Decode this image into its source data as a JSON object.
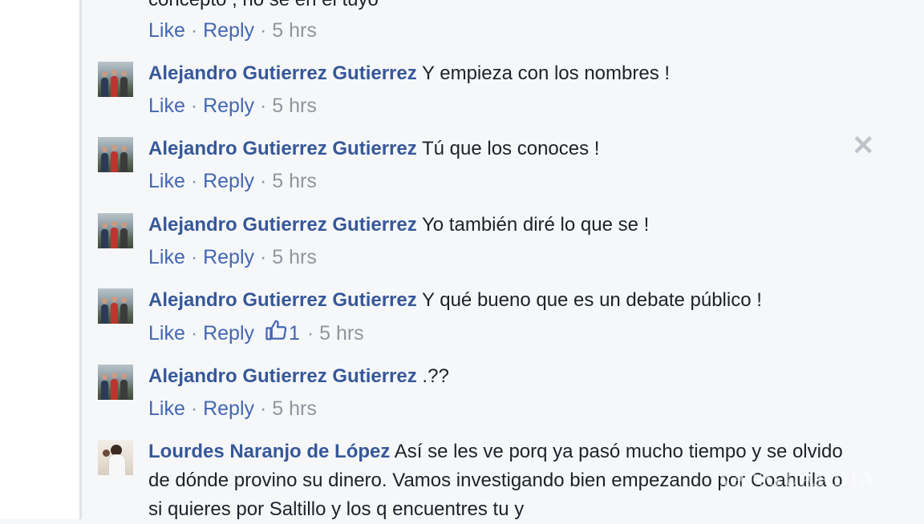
{
  "prev_comment": {
    "text_tail": "concepto , no se en el tuyo",
    "like_label": "Like",
    "reply_label": "Reply",
    "time": "5 hrs"
  },
  "comments": [
    {
      "author": "Alejandro Gutierrez Gutierrez",
      "text": "Y empieza con los nombres !",
      "like_label": "Like",
      "reply_label": "Reply",
      "time": "5 hrs"
    },
    {
      "author": "Alejandro Gutierrez Gutierrez",
      "text": "Tú que los conoces !",
      "like_label": "Like",
      "reply_label": "Reply",
      "time": "5 hrs"
    },
    {
      "author": "Alejandro Gutierrez Gutierrez",
      "text": "Yo también diré lo que se !",
      "like_label": "Like",
      "reply_label": "Reply",
      "time": "5 hrs"
    },
    {
      "author": "Alejandro Gutierrez Gutierrez",
      "text": "Y qué bueno que es un debate público !",
      "like_label": "Like",
      "reply_label": "Reply",
      "like_count": "1",
      "time": "5 hrs"
    },
    {
      "author": "Alejandro Gutierrez Gutierrez",
      "text": ".??",
      "like_label": "Like",
      "reply_label": "Reply",
      "time": "5 hrs"
    },
    {
      "author": "Lourdes Naranjo de López",
      "text": "Así se les ve porq ya pasó mucho tiempo y se olvido de dónde provino su dinero. Vamos investigando bien empezando por Coahuila o si quieres por Saltillo y los q encuentres tu y"
    }
  ],
  "separator": " · ",
  "watermark": "VANGUARDIA",
  "icons": {
    "close": "close-icon",
    "like": "thumbs-up-icon"
  },
  "colors": {
    "link": "#4267b2",
    "author": "#365899",
    "meta": "#90949c",
    "text": "#1d2129"
  }
}
